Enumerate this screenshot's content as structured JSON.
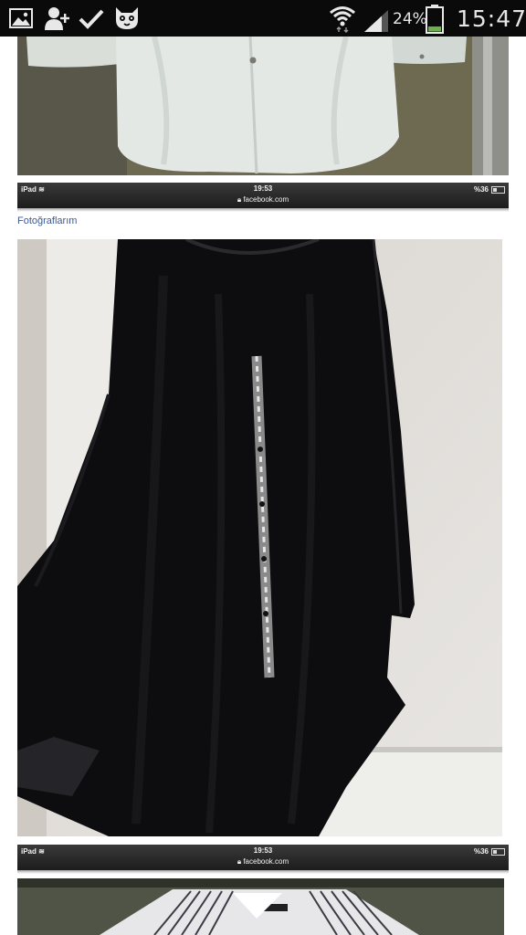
{
  "android_status": {
    "battery_percent": "24%",
    "time": "15:47",
    "icons": [
      "gallery-icon",
      "add-contact-icon",
      "checkmark-icon",
      "cat-app-icon",
      "wifi-icon",
      "cell-signal-icon",
      "battery-icon"
    ]
  },
  "ipad_bars": [
    {
      "carrier": "iPad",
      "time": "19:53",
      "url": "facebook.com",
      "battery": "%36"
    },
    {
      "carrier": "iPad",
      "time": "19:53",
      "url": "facebook.com",
      "battery": "%36"
    }
  ],
  "album_link": "Fotoğraflarım",
  "colors": {
    "facebook_link": "#3b5998",
    "battery_level": "#6ab04c"
  }
}
